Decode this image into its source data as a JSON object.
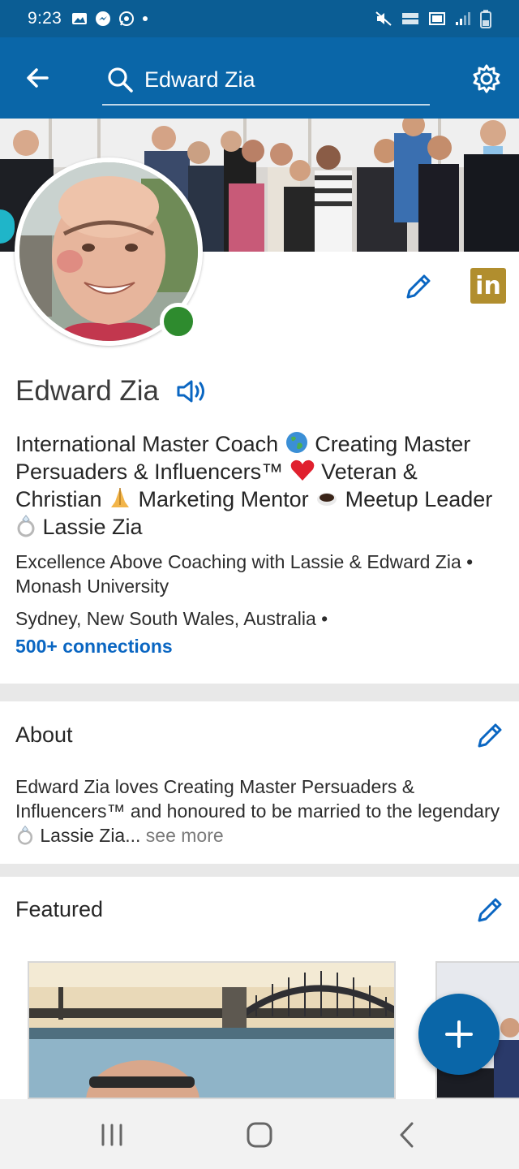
{
  "status_bar": {
    "time": "9:23"
  },
  "app_bar": {
    "search_text": "Edward Zia"
  },
  "profile": {
    "name": "Edward Zia",
    "headline_parts": {
      "p1": "International Master Coach ",
      "p2": " Creating Master Persuaders & Influencers™ ",
      "p3": " Veteran & Christian ",
      "p4": " Marketing Mentor ",
      "p5": " Meetup Leader ",
      "p6": " Lassie Zia"
    },
    "company": "Excellence Above Coaching with Lassie & Edward Zia • Monash University",
    "location": "Sydney, New South Wales, Australia •",
    "connections": "500+ connections",
    "badge_label": "in"
  },
  "about": {
    "title": "About",
    "text_part1": "Edward Zia loves Creating Master Persuaders & Influencers™ and honoured to be married to the legendary ",
    "text_part2": " Lassie Zia...",
    "see_more": " see more"
  },
  "featured": {
    "title": "Featured"
  },
  "colors": {
    "brand_blue": "#0a66a8",
    "status_bar": "#0b5d94",
    "link_blue": "#0a66c2",
    "online_green": "#2e8b2e",
    "linkedin_badge": "#b18e2e"
  },
  "icons": {
    "status": [
      "gallery-icon",
      "messenger-icon",
      "whatsapp-icon",
      "dot-icon"
    ],
    "system": [
      "mute-icon",
      "volte-icon",
      "lte-icon",
      "signal-icon",
      "battery-icon"
    ],
    "app_bar": [
      "back-arrow-icon",
      "search-icon",
      "settings-gear-icon"
    ],
    "profile": [
      "pencil-icon",
      "linkedin-icon",
      "speaker-icon",
      "globe-emoji",
      "heart-emoji",
      "praying-hands-emoji",
      "coffee-emoji",
      "ring-emoji"
    ],
    "nav": [
      "recent-apps-icon",
      "home-icon",
      "back-icon",
      "plus-icon"
    ]
  }
}
